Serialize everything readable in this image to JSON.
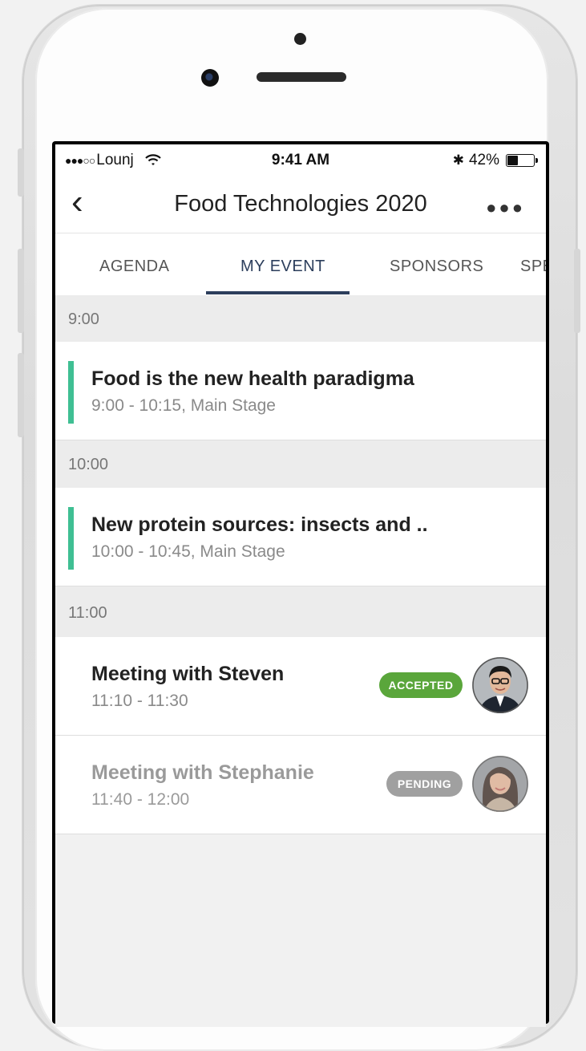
{
  "status_bar": {
    "signal_dots": "●●●○○",
    "carrier": "Lounj",
    "time": "9:41 AM",
    "bluetooth": "✱",
    "battery_percent": "42%",
    "battery_level": 0.42
  },
  "nav": {
    "back_glyph": "‹",
    "title": "Food Technologies 2020",
    "more_glyph": "●●●"
  },
  "tabs": [
    {
      "label": "AGENDA"
    },
    {
      "label": "MY EVENT"
    },
    {
      "label": "SPONSORS"
    },
    {
      "label": "SPE"
    }
  ],
  "active_tab": "MY EVENT",
  "schedule": {
    "sections": [
      {
        "time": "9:00",
        "items": [
          {
            "title": "Food is the new health paradigma",
            "subtitle": "9:00 - 10:15, Main Stage"
          }
        ]
      },
      {
        "time": "10:00",
        "items": [
          {
            "title": "New protein sources: insects and ..",
            "subtitle": "10:00 - 10:45, Main Stage"
          }
        ]
      },
      {
        "time": "11:00",
        "items": [
          {
            "title": "Meeting with Steven",
            "subtitle": "11:10 - 11:30",
            "status": "ACCEPTED"
          },
          {
            "title": "Meeting with Stephanie",
            "subtitle": "11:40 - 12:00",
            "status": "PENDING"
          }
        ]
      }
    ]
  },
  "colors": {
    "accent": "#2c3e5c",
    "session_bar": "#3fbf93",
    "accepted": "#5aa63b",
    "pending": "#a0a0a0"
  }
}
